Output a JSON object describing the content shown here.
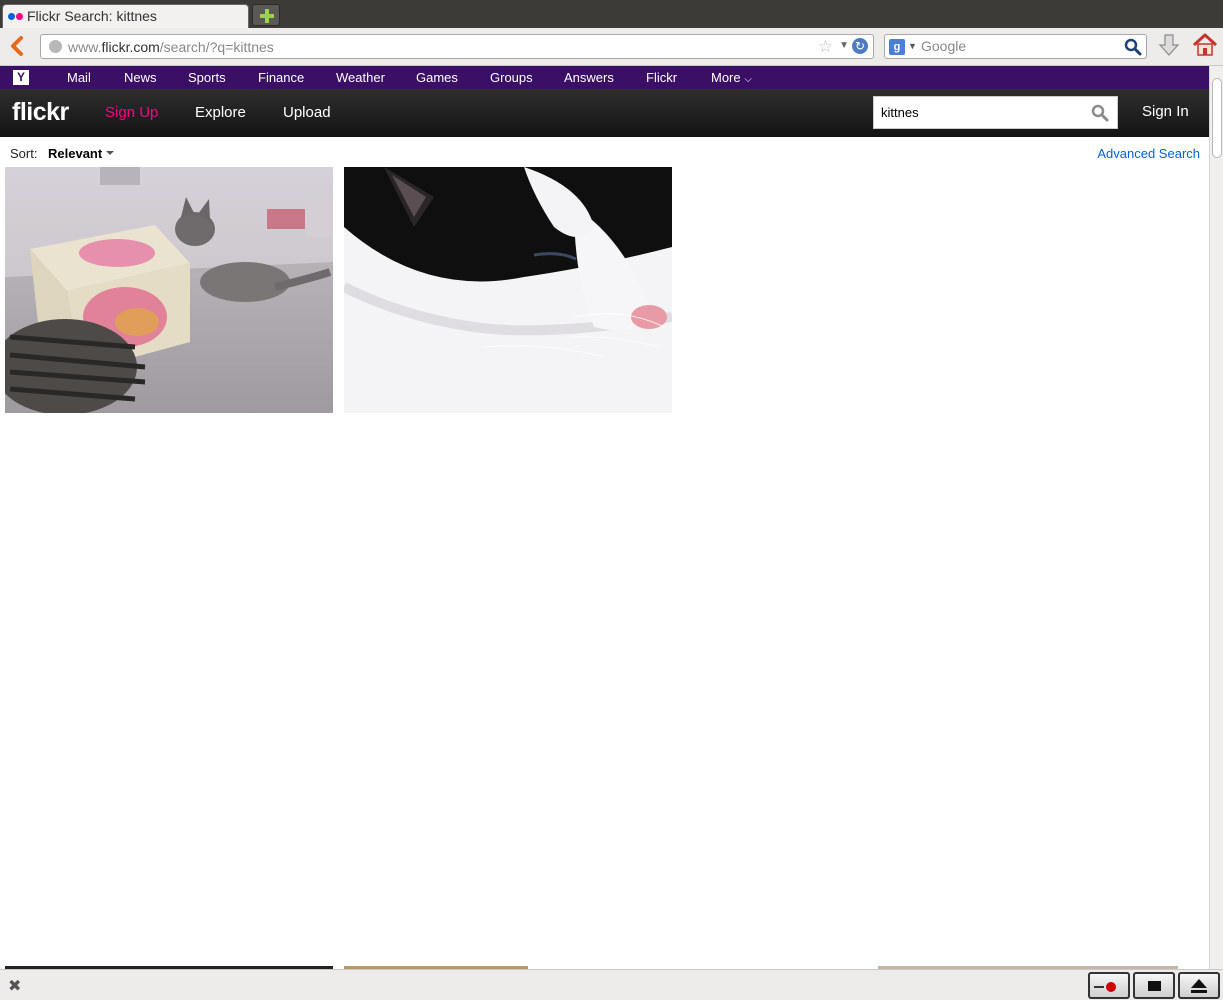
{
  "browser": {
    "tab_title": "Flickr Search: kittnes",
    "url_domain_prefix": "www.",
    "url_domain": "flickr.com",
    "url_path": "/search/?q=kittnes",
    "search_placeholder": "Google",
    "search_engine_letter": "g"
  },
  "yahoo_bar": {
    "logo": "Y",
    "items": [
      "Mail",
      "News",
      "Sports",
      "Finance",
      "Weather",
      "Games",
      "Groups",
      "Answers",
      "Flickr",
      "More"
    ]
  },
  "flickr": {
    "logo": "flickr",
    "nav": {
      "signup": "Sign Up",
      "explore": "Explore",
      "upload": "Upload"
    },
    "search_value": "kittnes",
    "signin": "Sign In"
  },
  "sort": {
    "label": "Sort:",
    "value": "Relevant",
    "advanced_search": "Advanced Search"
  },
  "colors": {
    "yahoo_purple": "#3b0f66",
    "flickr_pink": "#ff0084",
    "flickr_blue": "#0063dc"
  }
}
